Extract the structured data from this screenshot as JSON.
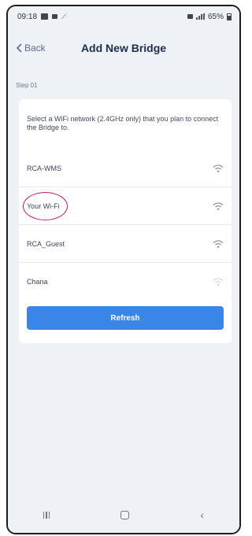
{
  "status_bar": {
    "time": "09:18",
    "battery_text": "65%"
  },
  "header": {
    "back_label": "Back",
    "title": "Add New Bridge"
  },
  "step_label": "Step 01",
  "instruction": "Select a WiFi network (2.4GHz only) that you plan to connect the Bridge to.",
  "networks": [
    {
      "name": "RCA-WMS",
      "signal": "strong"
    },
    {
      "name": "Your Wi-Fi",
      "signal": "strong",
      "highlighted": true
    },
    {
      "name": "RCA_Guest",
      "signal": "strong"
    },
    {
      "name": "Chana",
      "signal": "weak"
    }
  ],
  "refresh_label": "Refresh",
  "colors": {
    "accent": "#3a86e8",
    "highlight_ring": "#c2187a",
    "background": "#eef1f6"
  }
}
